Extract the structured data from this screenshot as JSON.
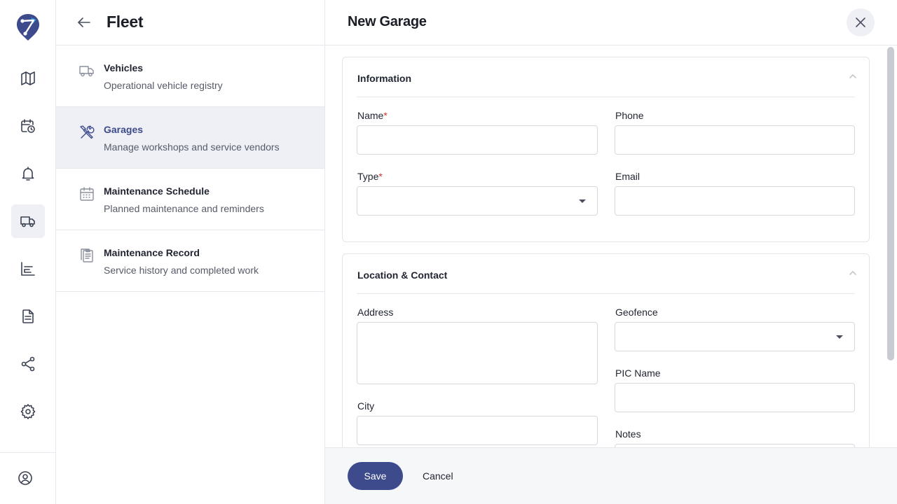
{
  "colors": {
    "accent": "#3d4a8c",
    "required": "#d0342c",
    "active_bg": "#eef0f5"
  },
  "rail": {
    "items": [
      {
        "icon": "map-icon"
      },
      {
        "icon": "calendar-clock-icon"
      },
      {
        "icon": "bell-icon"
      },
      {
        "icon": "truck-icon",
        "active": true
      },
      {
        "icon": "bar-chart-icon"
      },
      {
        "icon": "document-icon"
      },
      {
        "icon": "share-icon"
      },
      {
        "icon": "gear-icon"
      },
      {
        "icon": "user-circle-icon"
      }
    ]
  },
  "panel": {
    "title": "Fleet",
    "items": [
      {
        "icon": "truck-outline-icon",
        "title": "Vehicles",
        "subtitle": "Operational vehicle registry"
      },
      {
        "icon": "wrench-screwdriver-icon",
        "title": "Garages",
        "subtitle": "Manage workshops and service vendors",
        "active": true
      },
      {
        "icon": "calendar-icon",
        "title": "Maintenance Schedule",
        "subtitle": "Planned maintenance and reminders"
      },
      {
        "icon": "clipboard-copy-icon",
        "title": "Maintenance Record",
        "subtitle": "Service history and completed work"
      }
    ]
  },
  "form": {
    "title": "New Garage",
    "sections": {
      "information": {
        "title": "Information",
        "name_label": "Name",
        "phone_label": "Phone",
        "type_label": "Type",
        "email_label": "Email",
        "required_mark": "*",
        "name_value": "",
        "phone_value": "",
        "type_value": "",
        "email_value": ""
      },
      "location": {
        "title": "Location & Contact",
        "address_label": "Address",
        "geofence_label": "Geofence",
        "pic_name_label": "PIC Name",
        "city_label": "City",
        "notes_label": "Notes",
        "address_value": "",
        "geofence_value": "",
        "pic_name_value": "",
        "city_value": "",
        "notes_value": ""
      }
    },
    "actions": {
      "save_label": "Save",
      "cancel_label": "Cancel"
    }
  }
}
